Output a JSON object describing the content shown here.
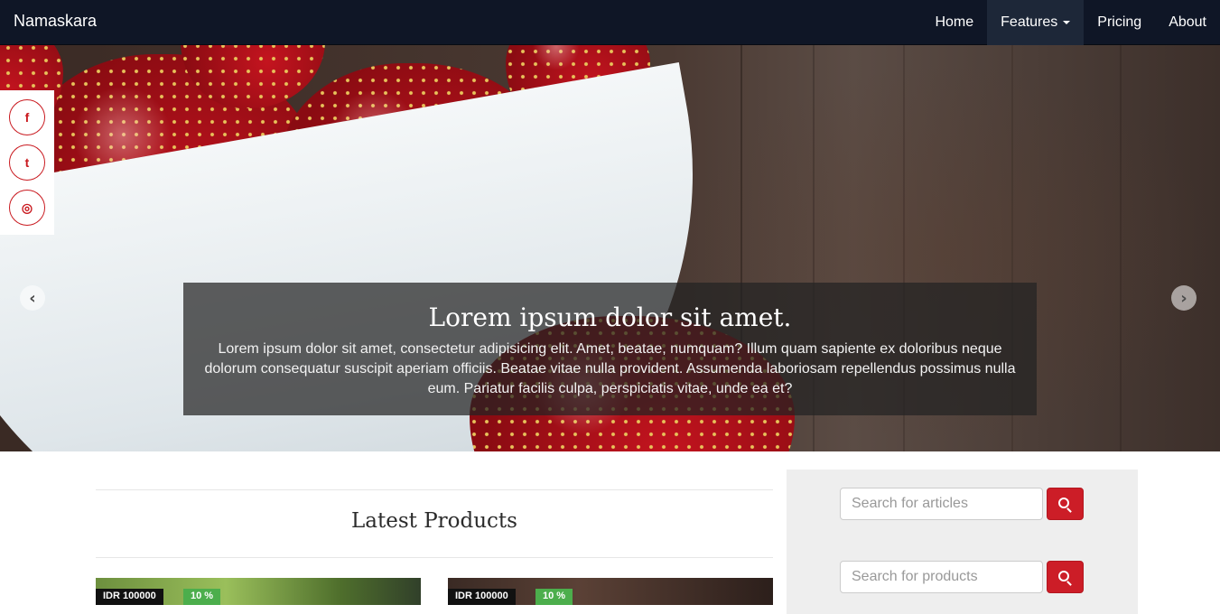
{
  "navbar": {
    "brand": "Namaskara",
    "items": [
      {
        "label": "Home",
        "active": false
      },
      {
        "label": "Features",
        "active": true,
        "dropdown": true
      },
      {
        "label": "Pricing",
        "active": false
      },
      {
        "label": "About",
        "active": false
      }
    ]
  },
  "social": {
    "icons": [
      "facebook-icon",
      "twitter-icon",
      "instagram-icon"
    ],
    "glyphs": {
      "facebook": "f",
      "twitter": "t",
      "instagram": "◎"
    }
  },
  "carousel": {
    "prev_glyph": "‹",
    "next_glyph": "›",
    "caption_title": "Lorem ipsum dolor sit amet.",
    "caption_text": "Lorem ipsum dolor sit amet, consectetur adipisicing elit. Amet, beatae, numquam? Illum quam sapiente ex doloribus neque dolorum consequatur suscipit aperiam officiis. Beatae vitae nulla provident. Assumenda laboriosam repellendus possimus nulla eum. Pariatur facilis culpa, perspiciatis vitae, unde ea et?"
  },
  "products": {
    "title": "Latest Products",
    "items": [
      {
        "price": "IDR 100000",
        "discount": "10 %"
      },
      {
        "price": "IDR 100000",
        "discount": "10 %"
      }
    ]
  },
  "sidebar": {
    "article_search_placeholder": "Search for articles",
    "product_search_placeholder": "Search for products"
  },
  "colors": {
    "navbar": "#0f1626",
    "accent_red": "#cc1d27",
    "discount_green": "#4cae4c",
    "sidebar_bg": "#eeeeee"
  }
}
